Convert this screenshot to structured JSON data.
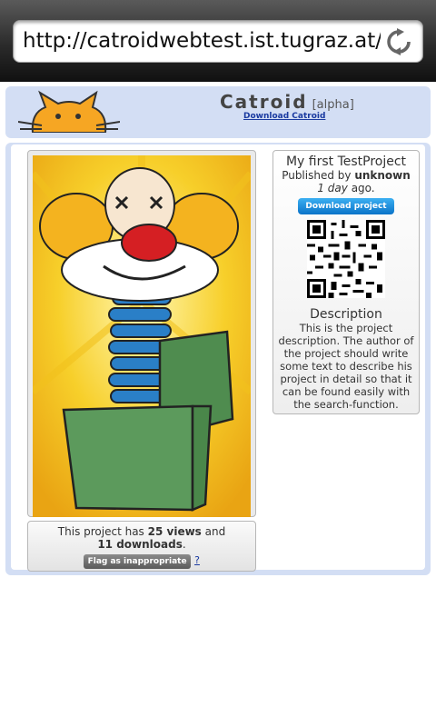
{
  "browser": {
    "url": "http://catroidwebtest.ist.tugraz.at/..."
  },
  "header": {
    "brand": "Catroid",
    "badge": "[alpha]",
    "download_link": "Download Catroid"
  },
  "project": {
    "title": "My first TestProject",
    "published_prefix": "Published by ",
    "author": "unknown",
    "age": "1 day",
    "age_suffix": " ago.",
    "download_button": "Download project",
    "description_heading": "Description",
    "description": "This is the project description. The author of the project should write some text to describe his project in detail so that it can be found easily with the search-function."
  },
  "stats": {
    "prefix": "This project has ",
    "views": "25 views",
    "middle": " and",
    "downloads": "11 downloads",
    "suffix": ".",
    "flag_button": "Flag as inappropriate",
    "help_link": "?"
  },
  "colors": {
    "header_bg": "#d3def4",
    "logo_orange": "#f6a623",
    "download_blue": "#0a73c8",
    "link_blue": "#1a3aa0"
  },
  "icons": {
    "reload": "reload-icon",
    "logo": "catroid-cat-logo",
    "qr": "qr-code"
  }
}
